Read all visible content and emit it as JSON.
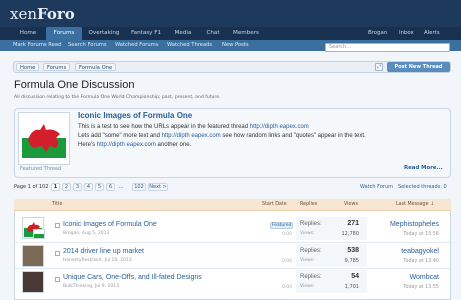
{
  "brand": {
    "name_light": "xen",
    "name_bold": "Foro"
  },
  "nav": {
    "tabs": [
      "Home",
      "Forums",
      "Overtaking",
      "Fantasy F1",
      "Media",
      "Chat",
      "Members"
    ],
    "right": [
      "Brogan",
      "Inbox",
      "Alerts"
    ]
  },
  "subnav": [
    "Mark Forums Read",
    "Search Forums",
    "Watched Forums",
    "Watched Threads",
    "New Posts"
  ],
  "search": {
    "placeholder": "Search..."
  },
  "breadcrumb": [
    "Home",
    "Forums",
    "Formula One"
  ],
  "post_button": "Post New Thread",
  "page": {
    "title": "Formula One Discussion",
    "description": "All discussion relating to the Formula One World Championship; past, present, and future."
  },
  "featured": {
    "title": "Iconic Images of Formula One",
    "line1a": "This is a test to see how the URLs appear in the featured thread ",
    "link": "http://dipth eapex.com",
    "line2a": "Lets add \"some\" more text and ",
    "line2b": " see how random links and \"quotes\" appear in the text.",
    "line3a": "Here's ",
    "line3b": " another one.",
    "label": "Featured Thread",
    "read_more": "Read More..."
  },
  "pagination": {
    "label": "Page 1 of 102",
    "pages": [
      "1",
      "2",
      "3",
      "4",
      "5",
      "6",
      "...",
      "102",
      "Next >"
    ],
    "watch": "Watch Forum",
    "selected": "Selected threads: 0"
  },
  "columns": {
    "title": "Title",
    "start_date": "Start Date",
    "replies": "Replies",
    "views": "Views",
    "last_message": "Last Message ↓"
  },
  "threads": [
    {
      "title": "Iconic Images of Formula One",
      "meta": "Brogan, Aug 5, 2013",
      "badge": "Featured",
      "ago": "0:00",
      "replies_label": "Replies:",
      "replies": "271",
      "views_label": "Views:",
      "views": "12,780",
      "last_user": "Mephistopheles",
      "last_date": "Today at 15:56"
    },
    {
      "title": "2014 driver line up market",
      "meta": "HonestyRestraint, Jul 10, 2013",
      "badge": "",
      "ago": "0:00",
      "replies_label": "Replies:",
      "replies": "538",
      "views_label": "Views:",
      "views": "9,785",
      "last_user": "teabagyokel",
      "last_date": "Today at 13:40"
    },
    {
      "title": "Unique Cars, One-Offs, and Ill-fated Designs",
      "meta": "BulkThinking, Jul 9, 2013",
      "badge": "",
      "ago": "0:00",
      "replies_label": "Replies:",
      "replies": "54",
      "views_label": "Views:",
      "views": "1,701",
      "last_user": "Wombcat",
      "last_date": "Today at 13:55"
    }
  ]
}
